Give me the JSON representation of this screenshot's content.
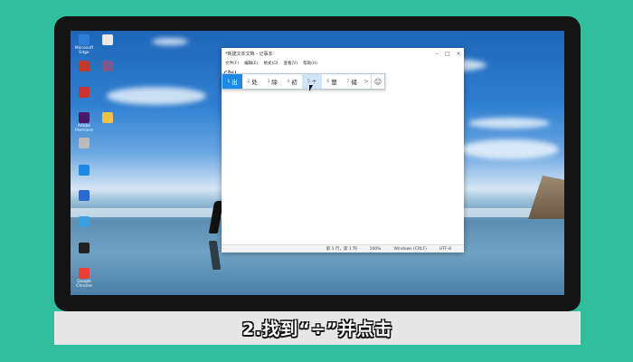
{
  "desktop": {
    "icons": [
      {
        "label": "Microsoft Edge",
        "icon": "edge-icon",
        "color": "#2f7fd8"
      },
      {
        "label": "",
        "icon": "file-icon",
        "color": "#e8e8e8"
      },
      {
        "label": "",
        "icon": "app-icon",
        "color": "#c0392b"
      },
      {
        "label": "",
        "icon": "app-icon",
        "color": "#7d5a8a"
      },
      {
        "label": "",
        "icon": "app-icon",
        "color": "#cc3333"
      },
      {
        "label": "Adobe Premiere",
        "icon": "premiere-icon",
        "color": "#4a1a6a"
      },
      {
        "label": "",
        "icon": "file-icon",
        "color": "#e8c24a"
      },
      {
        "label": "",
        "icon": "app-icon",
        "color": "#bbbbbb"
      },
      {
        "label": "",
        "icon": "app-icon",
        "color": "#1e88e5"
      },
      {
        "label": "",
        "icon": "app-icon",
        "color": "#2a6ad0"
      },
      {
        "label": "",
        "icon": "app-icon",
        "color": "#3aa0e0"
      },
      {
        "label": "",
        "icon": "app-icon",
        "color": "#222222"
      },
      {
        "label": "Google Chrome",
        "icon": "chrome-icon",
        "color": "#e94235"
      }
    ]
  },
  "notepad": {
    "title": "*新建文本文档 - 记事本",
    "menu": [
      "文件(F)",
      "编辑(E)",
      "格式(O)",
      "查看(V)",
      "帮助(H)"
    ],
    "typed_text": "chu",
    "status": {
      "position": "第 1 行，第 1 列",
      "zoom": "100%",
      "line_ending": "Windows (CRLF)",
      "encoding": "UTF-8"
    }
  },
  "ime": {
    "candidates": [
      {
        "num": "1",
        "text": "出",
        "state": "selected"
      },
      {
        "num": "2",
        "text": "处",
        "state": ""
      },
      {
        "num": "3",
        "text": "除",
        "state": ""
      },
      {
        "num": "4",
        "text": "初",
        "state": ""
      },
      {
        "num": "5",
        "text": "÷",
        "state": "hover"
      },
      {
        "num": "6",
        "text": "楚",
        "state": ""
      },
      {
        "num": "7",
        "text": "储",
        "state": ""
      }
    ],
    "next_arrow": ">",
    "emoji": "☺"
  },
  "caption": "2.找到“÷”并点击",
  "colors": {
    "background": "#2fbf9d",
    "ime_selected": "#1e88e5",
    "ime_hover": "#cfe4f7"
  }
}
